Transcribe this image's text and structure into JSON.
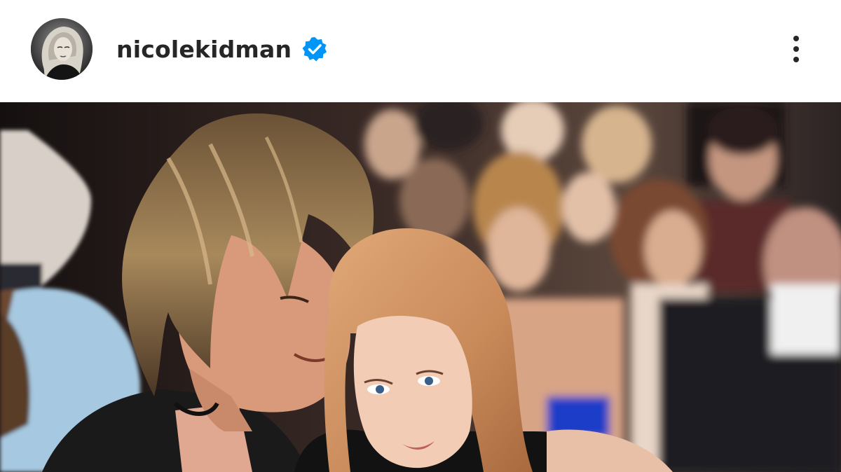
{
  "post": {
    "username": "nicolekidman",
    "verified": true,
    "avatar_icon": "profile-photo",
    "verified_icon": "verified-badge-icon",
    "more_icon": "more-options-vertical-icon",
    "image_icon": "photo-couple-at-event",
    "colors": {
      "username": "#262626",
      "verified_badge": "#0095f6",
      "background": "#ffffff"
    }
  }
}
